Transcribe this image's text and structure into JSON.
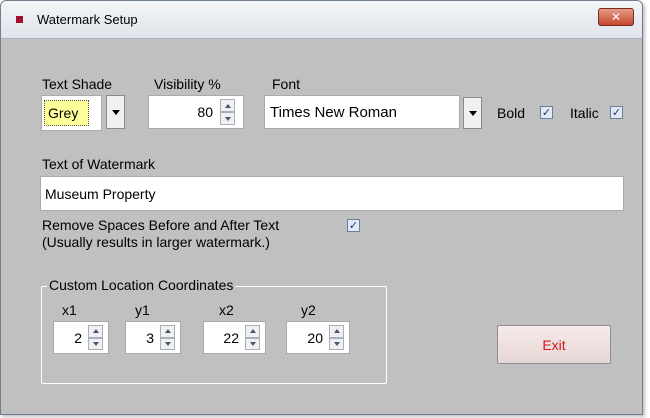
{
  "window": {
    "title": "Watermark Setup",
    "close_glyph": "✕"
  },
  "text_shade": {
    "label": "Text Shade",
    "value": "Grey",
    "highlight_color": "#ffff99"
  },
  "visibility": {
    "label": "Visibility %",
    "value": "80"
  },
  "font": {
    "label": "Font",
    "value": "Times New Roman",
    "bold_label": "Bold",
    "bold_checked": true,
    "italic_label": "Italic",
    "italic_checked": true
  },
  "watermark_text": {
    "label": "Text of Watermark",
    "value": "Museum Property"
  },
  "remove_spaces": {
    "label": "Remove Spaces Before and After Text",
    "note": "(Usually results in larger watermark.)",
    "checked": true
  },
  "coordinates": {
    "group_label": "Custom Location Coordinates",
    "x1": {
      "label": "x1",
      "value": "2"
    },
    "y1": {
      "label": "y1",
      "value": "3"
    },
    "x2": {
      "label": "x2",
      "value": "22"
    },
    "y2": {
      "label": "y2",
      "value": "20"
    }
  },
  "exit_button": {
    "label": "Exit",
    "text_color": "#d01818"
  },
  "colors": {
    "dialog_background": "#c0c0c0",
    "app_icon": "#a0102a",
    "close_button": "#c4472b"
  },
  "icons": [
    "app-icon",
    "close-icon",
    "dropdown-arrow-icon",
    "spin-up-icon",
    "spin-down-icon",
    "checkmark-icon"
  ]
}
